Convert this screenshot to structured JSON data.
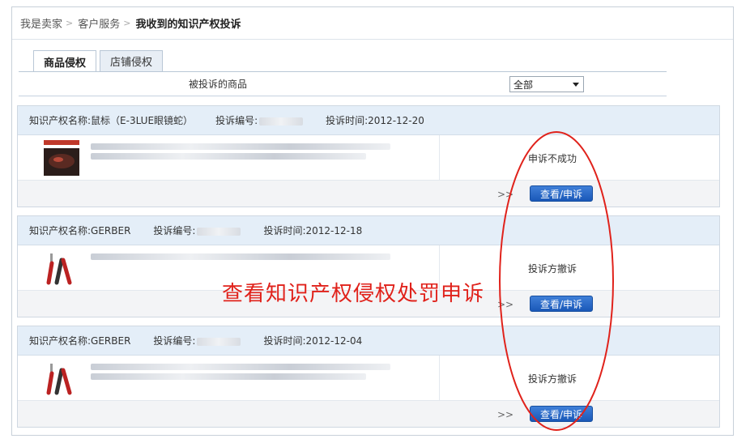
{
  "breadcrumb": {
    "items": [
      "我是卖家",
      "客户服务"
    ],
    "separator": ">",
    "current": "我收到的知识产权投诉"
  },
  "tabs": [
    {
      "label": "商品侵权",
      "active": true
    },
    {
      "label": "店铺侵权",
      "active": false
    }
  ],
  "list_header": {
    "product_col": "被投诉的商品",
    "filter_selected": "全部"
  },
  "field_labels": {
    "ip_name": "知识产权名称:",
    "complaint_no": "投诉编号:",
    "complaint_time": "投诉时间:"
  },
  "complaints": [
    {
      "ip_name": "鼠标（E-3LUE眼镜蛇）",
      "time": "2012-12-20",
      "status": "申诉不成功",
      "more": ">>",
      "action": "查看/申诉"
    },
    {
      "ip_name": "GERBER",
      "time": "2012-12-18",
      "status": "投诉方撤诉",
      "more": ">>",
      "action": "查看/申诉"
    },
    {
      "ip_name": "GERBER",
      "time": "2012-12-04",
      "status": "投诉方撤诉",
      "more": ">>",
      "action": "查看/申诉"
    }
  ],
  "annotation": {
    "text": "查看知识产权侵权处罚申诉",
    "color": "#e0221b"
  },
  "colors": {
    "accent_button": "#1a58b8",
    "card_header": "#e4eef8"
  }
}
